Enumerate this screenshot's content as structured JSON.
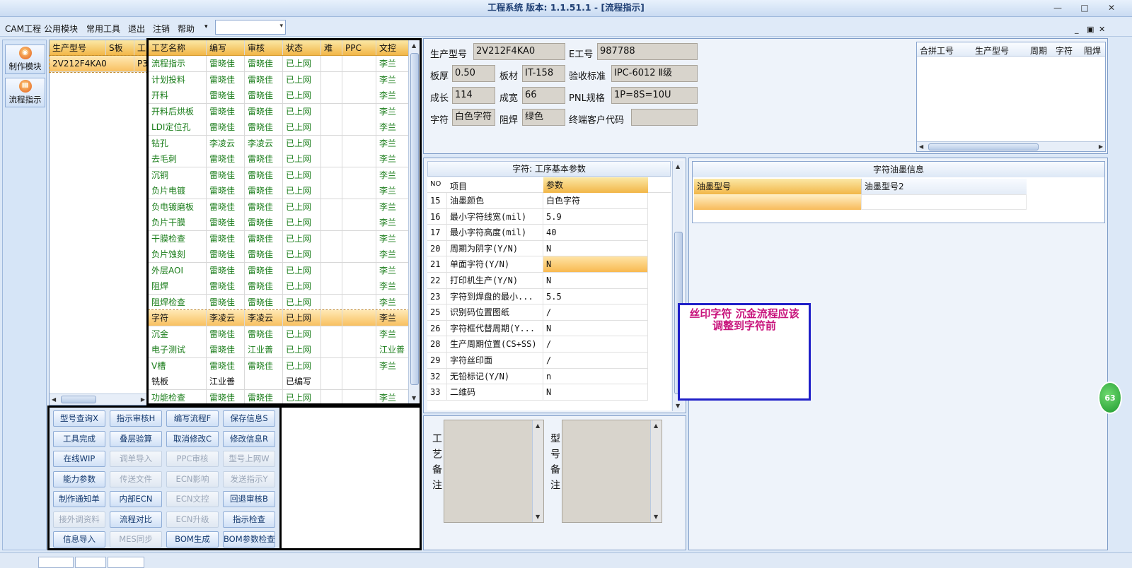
{
  "window": {
    "title": "工程系统  版本: 1.1.51.1 - [流程指示]",
    "controls": [
      "—",
      "□",
      "✕"
    ],
    "mdi_controls": [
      "_",
      "▣",
      "✕"
    ]
  },
  "menu": {
    "items": [
      "CAM工程",
      "公用模块",
      "常用工具",
      "退出",
      "注销",
      "帮助"
    ],
    "dropdown_arrow": "▾",
    "combo_value": ""
  },
  "sidebar": {
    "items": [
      {
        "label": "制作模块",
        "icon": "fire-icon",
        "glyph": "◉"
      },
      {
        "label": "流程指示",
        "icon": "flow-icon",
        "glyph": "Ⅲ"
      }
    ]
  },
  "model_grid": {
    "columns": [
      "生产型号",
      "S板",
      "工"
    ],
    "rows": [
      [
        "2V212F4KA0",
        "",
        "P3"
      ]
    ]
  },
  "process_grid": {
    "columns": [
      "工艺名称",
      "编写",
      "审核",
      "状态",
      "难",
      "PPC",
      "文控"
    ],
    "rows": [
      [
        "流程指示",
        "雷晓佳",
        "雷晓佳",
        "已上网",
        "",
        "",
        "李兰"
      ],
      [
        "计划投料",
        "雷晓佳",
        "雷晓佳",
        "已上网",
        "",
        "",
        "李兰"
      ],
      [
        "开料",
        "雷晓佳",
        "雷晓佳",
        "已上网",
        "",
        "",
        "李兰"
      ],
      [
        "开料后烘板",
        "雷晓佳",
        "雷晓佳",
        "已上网",
        "",
        "",
        "李兰"
      ],
      [
        "LDI定位孔",
        "雷晓佳",
        "雷晓佳",
        "已上网",
        "",
        "",
        "李兰"
      ],
      [
        "钻孔",
        "李凌云",
        "李凌云",
        "已上网",
        "",
        "",
        "李兰"
      ],
      [
        "去毛刺",
        "雷晓佳",
        "雷晓佳",
        "已上网",
        "",
        "",
        "李兰"
      ],
      [
        "沉铜",
        "雷晓佳",
        "雷晓佳",
        "已上网",
        "",
        "",
        "李兰"
      ],
      [
        "负片电镀",
        "雷晓佳",
        "雷晓佳",
        "已上网",
        "",
        "",
        "李兰"
      ],
      [
        "负电镀磨板",
        "雷晓佳",
        "雷晓佳",
        "已上网",
        "",
        "",
        "李兰"
      ],
      [
        "负片干膜",
        "雷晓佳",
        "雷晓佳",
        "已上网",
        "",
        "",
        "李兰"
      ],
      [
        "干膜检查",
        "雷晓佳",
        "雷晓佳",
        "已上网",
        "",
        "",
        "李兰"
      ],
      [
        "负片蚀刻",
        "雷晓佳",
        "雷晓佳",
        "已上网",
        "",
        "",
        "李兰"
      ],
      [
        "外层AOI",
        "雷晓佳",
        "雷晓佳",
        "已上网",
        "",
        "",
        "李兰"
      ],
      [
        "阻焊",
        "雷晓佳",
        "雷晓佳",
        "已上网",
        "",
        "",
        "李兰"
      ],
      [
        "阻焊检查",
        "雷晓佳",
        "雷晓佳",
        "已上网",
        "",
        "",
        "李兰"
      ],
      [
        "字符",
        "李凌云",
        "李凌云",
        "已上网",
        "",
        "",
        "李兰"
      ],
      [
        "沉金",
        "雷晓佳",
        "雷晓佳",
        "已上网",
        "",
        "",
        "李兰"
      ],
      [
        "电子测试",
        "雷晓佳",
        "江业善",
        "已上网",
        "",
        "",
        "江业善"
      ],
      [
        "V槽",
        "雷晓佳",
        "雷晓佳",
        "已上网",
        "",
        "",
        "李兰"
      ],
      [
        "铣板",
        "江业善",
        "",
        "已编写",
        "",
        "",
        ""
      ],
      [
        "功能检查",
        "雷晓佳",
        "雷晓佳",
        "已上网",
        "",
        "",
        "李兰"
      ]
    ],
    "selected_index": 16
  },
  "actions": {
    "buttons": [
      [
        "型号查询X",
        "指示审核H",
        "编写流程F",
        "保存信息S"
      ],
      [
        "工具完成",
        "叠层验算",
        "取消修改C",
        "修改信息R"
      ],
      [
        "在线WIP",
        "调单导入",
        "PPC审核",
        "型号上网W"
      ],
      [
        "能力参数",
        "传送文件",
        "ECN影响",
        "发送指示Y"
      ],
      [
        "制作通知单",
        "内部ECN",
        "ECN文控",
        "回退审核B"
      ],
      [
        "接外调资料",
        "流程对比",
        "ECN升级",
        "指示检查"
      ],
      [
        "信息导入",
        "MES同步",
        "BOM生成",
        "BOM参数检查"
      ]
    ],
    "disabled": [
      [],
      [],
      [
        1,
        2,
        3
      ],
      [
        1,
        2,
        3
      ],
      [
        2
      ],
      [
        0,
        2
      ],
      [
        1
      ]
    ]
  },
  "info": {
    "fields": [
      {
        "label": "生产型号",
        "value": "2V212F4KA0"
      },
      {
        "label": "E工号",
        "value": "987788"
      },
      {
        "label": "板厚",
        "value": "0.50"
      },
      {
        "label": "板材",
        "value": "IT-158"
      },
      {
        "label": "验收标准",
        "value": "IPC-6012 Ⅱ级"
      },
      {
        "label": "成长",
        "value": "114"
      },
      {
        "label": "成宽",
        "value": "66"
      },
      {
        "label": "PNL规格",
        "value": "1P=8S=10U"
      },
      {
        "label": "字符",
        "value": "白色字符"
      },
      {
        "label": "阻焊",
        "value": "绿色"
      },
      {
        "label": "终端客户代码",
        "value": ""
      }
    ]
  },
  "merge_grid": {
    "columns": [
      "合拼工号",
      "生产型号",
      "周期",
      "字符",
      "阻焊"
    ]
  },
  "params": {
    "title": "字符: 工序基本参数",
    "columns": [
      "NO",
      "项目",
      "参数"
    ],
    "rows": [
      [
        "15",
        "油墨颜色",
        "白色字符"
      ],
      [
        "16",
        "最小字符线宽(mil)",
        "5.9"
      ],
      [
        "17",
        "最小字符高度(mil)",
        "40"
      ],
      [
        "20",
        "周期为阴字(Y/N)",
        "N"
      ],
      [
        "21",
        "单面字符(Y/N)",
        "N"
      ],
      [
        "22",
        "打印机生产(Y/N)",
        "N"
      ],
      [
        "23",
        "字符到焊盘的最小...",
        "5.5"
      ],
      [
        "25",
        "识别码位置图纸",
        "/"
      ],
      [
        "26",
        "字符框代替周期(Y...",
        "N"
      ],
      [
        "28",
        "生产周期位置(CS+SS)",
        "/"
      ],
      [
        "29",
        "字符丝印面",
        "/"
      ],
      [
        "32",
        "无铅标记(Y/N)",
        "n"
      ],
      [
        "33",
        "二维码",
        "N"
      ]
    ],
    "highlight_index": 4
  },
  "ink": {
    "title": "字符油墨信息",
    "columns": [
      "油墨型号",
      "油墨型号2"
    ]
  },
  "remarks": {
    "process_label": "工艺备注",
    "model_label": "型号备注"
  },
  "note": {
    "text": "丝印字符   沉金流程应该调整到字符前"
  },
  "bubble": {
    "text": "63"
  },
  "status": {
    "tabs": [
      "",
      "",
      ""
    ]
  }
}
